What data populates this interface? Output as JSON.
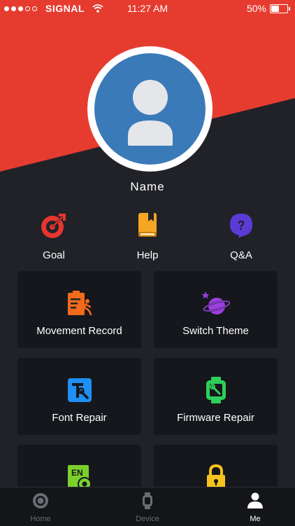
{
  "status_bar": {
    "signal_dots_filled": 3,
    "carrier": "SIGNAL",
    "time": "11:27 AM",
    "battery_text": "50%",
    "battery_level": 0.5
  },
  "profile": {
    "name": "Name"
  },
  "shortcuts": [
    {
      "label": "Goal",
      "icon": "goal-icon"
    },
    {
      "label": "Help",
      "icon": "help-book-icon"
    },
    {
      "label": "Q&A",
      "icon": "qa-icon"
    }
  ],
  "cards": [
    {
      "label": "Movement Record",
      "icon": "movement-record-icon"
    },
    {
      "label": "Switch Theme",
      "icon": "planet-theme-icon"
    },
    {
      "label": "Font Repair",
      "icon": "font-repair-icon"
    },
    {
      "label": "Firmware Repair",
      "icon": "firmware-repair-icon"
    },
    {
      "label": "",
      "icon": "language-en-settings-icon"
    },
    {
      "label": "",
      "icon": "lock-icon"
    }
  ],
  "tabs": [
    {
      "label": "Home",
      "icon": "home-ring-icon",
      "active": false
    },
    {
      "label": "Device",
      "icon": "watch-icon",
      "active": false
    },
    {
      "label": "Me",
      "icon": "person-icon",
      "active": true
    }
  ],
  "colors": {
    "hero_red": "#e63c30",
    "background": "#202228",
    "card": "#15171c",
    "avatar_blue": "#3b7ab8",
    "goal_red": "#e8352f",
    "help_orange": "#f5a623",
    "qa_purple": "#5b3bd6",
    "movement_orange": "#f26a1b",
    "theme_purple": "#9b3fe0",
    "font_blue": "#1e8ff5",
    "firmware_green": "#2fcf5a",
    "lang_green": "#7ad12c",
    "lock_yellow": "#f7c21b"
  }
}
